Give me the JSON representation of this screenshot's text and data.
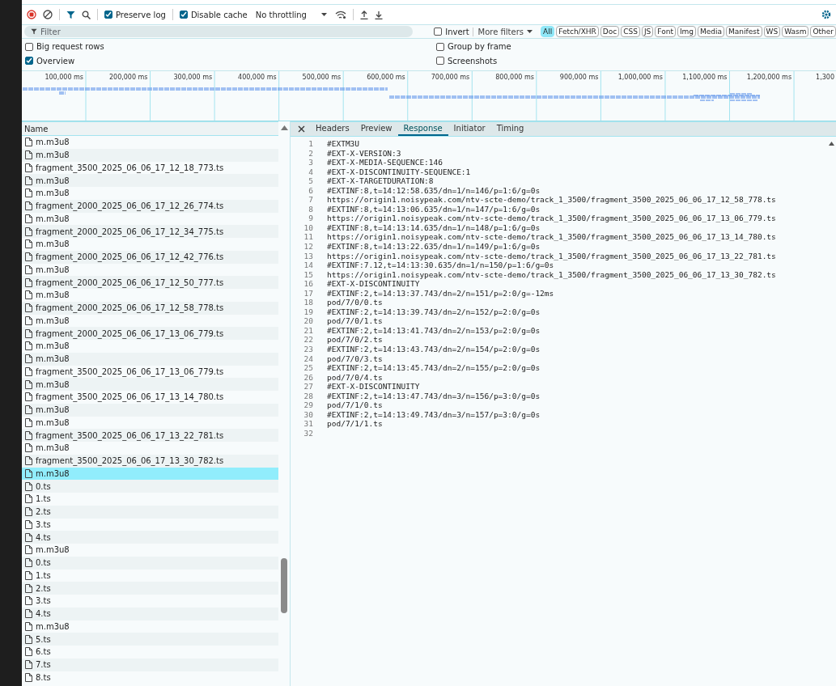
{
  "toolbar": {
    "preserve_log": {
      "label": "Preserve log",
      "checked": true
    },
    "disable_cache": {
      "label": "Disable cache",
      "checked": true
    },
    "throttling": "No throttling"
  },
  "filter_bar": {
    "placeholder": "Filter",
    "invert": {
      "label": "Invert",
      "checked": false
    },
    "more_filters": "More filters",
    "types": [
      {
        "label": "All",
        "selected": true
      },
      {
        "label": "Fetch/XHR",
        "selected": false
      },
      {
        "label": "Doc",
        "selected": false
      },
      {
        "label": "CSS",
        "selected": false
      },
      {
        "label": "JS",
        "selected": false
      },
      {
        "label": "Font",
        "selected": false
      },
      {
        "label": "Img",
        "selected": false
      },
      {
        "label": "Media",
        "selected": false
      },
      {
        "label": "Manifest",
        "selected": false
      },
      {
        "label": "WS",
        "selected": false
      },
      {
        "label": "Wasm",
        "selected": false
      },
      {
        "label": "Other",
        "selected": false
      }
    ]
  },
  "options": [
    {
      "label": "Big request rows",
      "checked": false
    },
    {
      "label": "Group by frame",
      "checked": false
    },
    {
      "label": "Overview",
      "checked": true
    },
    {
      "label": "Screenshots",
      "checked": false
    }
  ],
  "timeline": {
    "ticks": [
      "100,000 ms",
      "200,000 ms",
      "300,000 ms",
      "400,000 ms",
      "500,000 ms",
      "600,000 ms",
      "700,000 ms",
      "800,000 ms",
      "900,000 ms",
      "1,000,000 ms",
      "1,100,000 ms",
      "1,200,000 ms",
      "1,300"
    ]
  },
  "requests": {
    "column": "Name",
    "rows": [
      {
        "name": "m.m3u8",
        "selected": false
      },
      {
        "name": "m.m3u8",
        "selected": false
      },
      {
        "name": "fragment_3500_2025_06_06_17_12_18_773.ts",
        "selected": false
      },
      {
        "name": "m.m3u8",
        "selected": false
      },
      {
        "name": "m.m3u8",
        "selected": false
      },
      {
        "name": "fragment_2000_2025_06_06_17_12_26_774.ts",
        "selected": false
      },
      {
        "name": "m.m3u8",
        "selected": false
      },
      {
        "name": "fragment_2000_2025_06_06_17_12_34_775.ts",
        "selected": false
      },
      {
        "name": "m.m3u8",
        "selected": false
      },
      {
        "name": "fragment_2000_2025_06_06_17_12_42_776.ts",
        "selected": false
      },
      {
        "name": "m.m3u8",
        "selected": false
      },
      {
        "name": "fragment_2000_2025_06_06_17_12_50_777.ts",
        "selected": false
      },
      {
        "name": "m.m3u8",
        "selected": false
      },
      {
        "name": "fragment_2000_2025_06_06_17_12_58_778.ts",
        "selected": false
      },
      {
        "name": "m.m3u8",
        "selected": false
      },
      {
        "name": "fragment_2000_2025_06_06_17_13_06_779.ts",
        "selected": false
      },
      {
        "name": "m.m3u8",
        "selected": false
      },
      {
        "name": "m.m3u8",
        "selected": false
      },
      {
        "name": "fragment_3500_2025_06_06_17_13_06_779.ts",
        "selected": false
      },
      {
        "name": "m.m3u8",
        "selected": false
      },
      {
        "name": "fragment_3500_2025_06_06_17_13_14_780.ts",
        "selected": false
      },
      {
        "name": "m.m3u8",
        "selected": false
      },
      {
        "name": "m.m3u8",
        "selected": false
      },
      {
        "name": "fragment_3500_2025_06_06_17_13_22_781.ts",
        "selected": false
      },
      {
        "name": "m.m3u8",
        "selected": false
      },
      {
        "name": "fragment_3500_2025_06_06_17_13_30_782.ts",
        "selected": false
      },
      {
        "name": "m.m3u8",
        "selected": true
      },
      {
        "name": "0.ts",
        "selected": false
      },
      {
        "name": "1.ts",
        "selected": false
      },
      {
        "name": "2.ts",
        "selected": false
      },
      {
        "name": "3.ts",
        "selected": false
      },
      {
        "name": "4.ts",
        "selected": false
      },
      {
        "name": "m.m3u8",
        "selected": false
      },
      {
        "name": "0.ts",
        "selected": false
      },
      {
        "name": "1.ts",
        "selected": false
      },
      {
        "name": "2.ts",
        "selected": false
      },
      {
        "name": "3.ts",
        "selected": false
      },
      {
        "name": "4.ts",
        "selected": false
      },
      {
        "name": "m.m3u8",
        "selected": false
      },
      {
        "name": "5.ts",
        "selected": false
      },
      {
        "name": "6.ts",
        "selected": false
      },
      {
        "name": "7.ts",
        "selected": false
      },
      {
        "name": "8.ts",
        "selected": false
      }
    ]
  },
  "details": {
    "tabs": [
      {
        "label": "Headers",
        "selected": false
      },
      {
        "label": "Preview",
        "selected": false
      },
      {
        "label": "Response",
        "selected": true
      },
      {
        "label": "Initiator",
        "selected": false
      },
      {
        "label": "Timing",
        "selected": false
      }
    ],
    "lines": [
      {
        "number": "1",
        "text": "#EXTM3U"
      },
      {
        "number": "2",
        "text": "#EXT-X-VERSION:3"
      },
      {
        "number": "3",
        "text": "#EXT-X-MEDIA-SEQUENCE:146"
      },
      {
        "number": "4",
        "text": "#EXT-X-DISCONTINUITY-SEQUENCE:1"
      },
      {
        "number": "5",
        "text": "#EXT-X-TARGETDURATION:8"
      },
      {
        "number": "6",
        "text": "#EXTINF:8,t=14:12:58.635/dn=1/n=146/p=1:6/g=0s"
      },
      {
        "number": "7",
        "text": "https://origin1.noisypeak.com/ntv-scte-demo/track_1_3500/fragment_3500_2025_06_06_17_12_58_778.ts"
      },
      {
        "number": "8",
        "text": "#EXTINF:8,t=14:13:06.635/dn=1/n=147/p=1:6/g=0s"
      },
      {
        "number": "9",
        "text": "https://origin1.noisypeak.com/ntv-scte-demo/track_1_3500/fragment_3500_2025_06_06_17_13_06_779.ts"
      },
      {
        "number": "10",
        "text": "#EXTINF:8,t=14:13:14.635/dn=1/n=148/p=1:6/g=0s"
      },
      {
        "number": "11",
        "text": "https://origin1.noisypeak.com/ntv-scte-demo/track_1_3500/fragment_3500_2025_06_06_17_13_14_780.ts"
      },
      {
        "number": "12",
        "text": "#EXTINF:8,t=14:13:22.635/dn=1/n=149/p=1:6/g=0s"
      },
      {
        "number": "13",
        "text": "https://origin1.noisypeak.com/ntv-scte-demo/track_1_3500/fragment_3500_2025_06_06_17_13_22_781.ts"
      },
      {
        "number": "14",
        "text": "#EXTINF:7.12,t=14:13:30.635/dn=1/n=150/p=1:6/g=0s"
      },
      {
        "number": "15",
        "text": "https://origin1.noisypeak.com/ntv-scte-demo/track_1_3500/fragment_3500_2025_06_06_17_13_30_782.ts"
      },
      {
        "number": "16",
        "text": "#EXT-X-DISCONTINUITY"
      },
      {
        "number": "17",
        "text": "#EXTINF:2,t=14:13:37.743/dn=2/n=151/p=2:0/g=-12ms"
      },
      {
        "number": "18",
        "text": "pod/7/0/0.ts"
      },
      {
        "number": "19",
        "text": "#EXTINF:2,t=14:13:39.743/dn=2/n=152/p=2:0/g=0s"
      },
      {
        "number": "20",
        "text": "pod/7/0/1.ts"
      },
      {
        "number": "21",
        "text": "#EXTINF:2,t=14:13:41.743/dn=2/n=153/p=2:0/g=0s"
      },
      {
        "number": "22",
        "text": "pod/7/0/2.ts"
      },
      {
        "number": "23",
        "text": "#EXTINF:2,t=14:13:43.743/dn=2/n=154/p=2:0/g=0s"
      },
      {
        "number": "24",
        "text": "pod/7/0/3.ts"
      },
      {
        "number": "25",
        "text": "#EXTINF:2,t=14:13:45.743/dn=2/n=155/p=2:0/g=0s"
      },
      {
        "number": "26",
        "text": "pod/7/0/4.ts"
      },
      {
        "number": "27",
        "text": "#EXT-X-DISCONTINUITY"
      },
      {
        "number": "28",
        "text": "#EXTINF:2,t=14:13:47.743/dn=3/n=156/p=3:0/g=0s"
      },
      {
        "number": "29",
        "text": "pod/7/1/0.ts"
      },
      {
        "number": "30",
        "text": "#EXTINF:2,t=14:13:49.743/dn=3/n=157/p=3:0/g=0s"
      },
      {
        "number": "31",
        "text": "pod/7/1/1.ts"
      },
      {
        "number": "32"
      }
    ]
  }
}
